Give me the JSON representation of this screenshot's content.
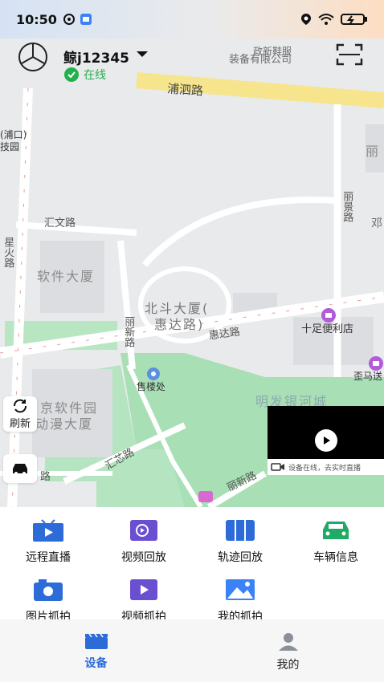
{
  "status_bar": {
    "time": "10:50"
  },
  "header": {
    "device_name": "鲸j12345",
    "online_text": "在线"
  },
  "map": {
    "labels": {
      "company": "装备有限公司",
      "company_top": "政新鞋服",
      "pusi_road": "浦泗路",
      "pukou": "(浦口)",
      "tech_park": "技园",
      "huiwen_road": "汇文路",
      "xinghuo_road": "星火路",
      "software_building": "软件大厦",
      "beidou_building": "北斗大厦(",
      "huida_road_paren": "惠达路)",
      "lijing_road": "丽景路",
      "lixin_road": "丽新路",
      "huida_road": "惠达路",
      "shizu_store": "十足便利店",
      "sales_office": "售楼处",
      "mingfa_city": "明发银河城",
      "jing_software_park": "京软件园",
      "animation_building": "动漫大厦",
      "huixin_road": "汇芯路",
      "lixin_road2": "丽新路",
      "li_edge": "丽",
      "deng_edge": "邓",
      "jinma_edge": "歪马送",
      "road_edge": "路"
    }
  },
  "side": {
    "refresh_label": "刷新"
  },
  "video": {
    "caption": "设备在线，去实时直播"
  },
  "functions": [
    {
      "label": "远程直播",
      "icon": "live-tv-icon"
    },
    {
      "label": "视频回放",
      "icon": "video-replay-icon"
    },
    {
      "label": "轨迹回放",
      "icon": "track-map-icon"
    },
    {
      "label": "车辆信息",
      "icon": "car-info-icon"
    },
    {
      "label": "图片抓拍",
      "icon": "camera-icon"
    },
    {
      "label": "视频抓拍",
      "icon": "video-capture-icon"
    },
    {
      "label": "我的抓拍",
      "icon": "gallery-icon"
    }
  ],
  "nav": {
    "tabs": [
      {
        "label": "设备",
        "icon": "clapper-icon",
        "active": true
      },
      {
        "label": "我的",
        "icon": "person-icon",
        "active": false
      }
    ]
  },
  "colors": {
    "accent_blue": "#2d6bd9",
    "online_green": "#22b14c",
    "map_bg": "#e9eaec",
    "park_green": "#a8dfb5"
  }
}
